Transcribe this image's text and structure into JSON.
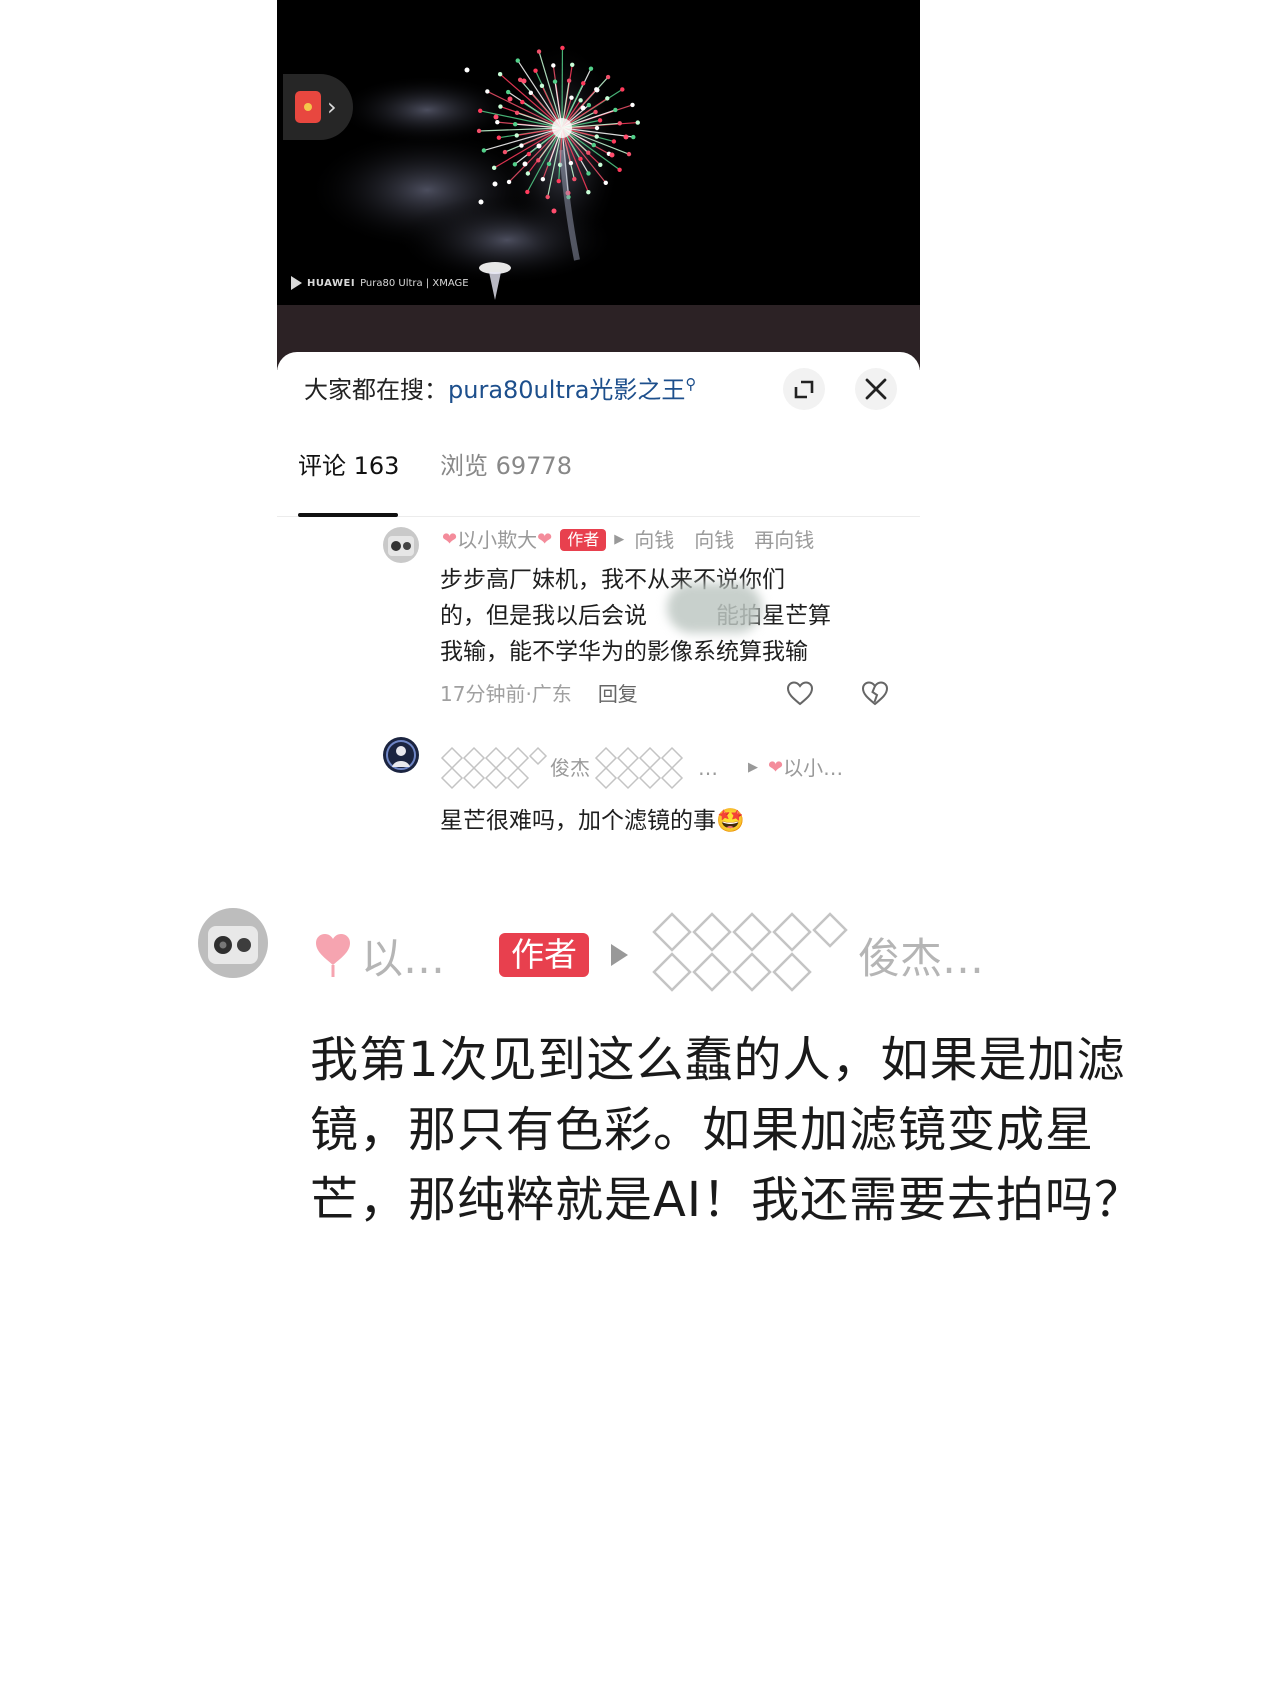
{
  "video": {
    "watermark_brand": "HUAWEI",
    "watermark_model": "Pura80 Ultra | XMAGE"
  },
  "search": {
    "prefix": "大家都在搜：",
    "term": "pura80ultra光影之王"
  },
  "tabs": [
    {
      "label": "评论 163",
      "active": true
    },
    {
      "label": "浏览 69778",
      "active": false
    }
  ],
  "comments": [
    {
      "name": "以小欺大",
      "badge": "作者",
      "reply_to": "向钱　向钱　再向钱",
      "body_lines": [
        "步步高厂妹机，我不从来不说你们",
        "的，但是我以后会说　　　能拍星芒算",
        "我输，能不学华为的影像系统算我输"
      ],
      "time": "17分钟前·广东",
      "reply_label": "回复"
    },
    {
      "name": "俊杰",
      "name_suffix": "…",
      "reply_to": "以小…",
      "body": "星芒很难吗，加个滤镜的事",
      "emoji": "🤩"
    }
  ],
  "zoom": {
    "name": "以…",
    "badge": "作者",
    "reply_to": "俊杰…",
    "body": "我第1次见到这么蠢的人，如果是加滤镜，那只有色彩。如果加滤镜变成星芒，那纯粹就是AI！我还需要去拍吗？"
  },
  "colors": {
    "author_badge": "#e8404e",
    "search_link": "#1d4f8c",
    "video_bg": "#000000"
  }
}
